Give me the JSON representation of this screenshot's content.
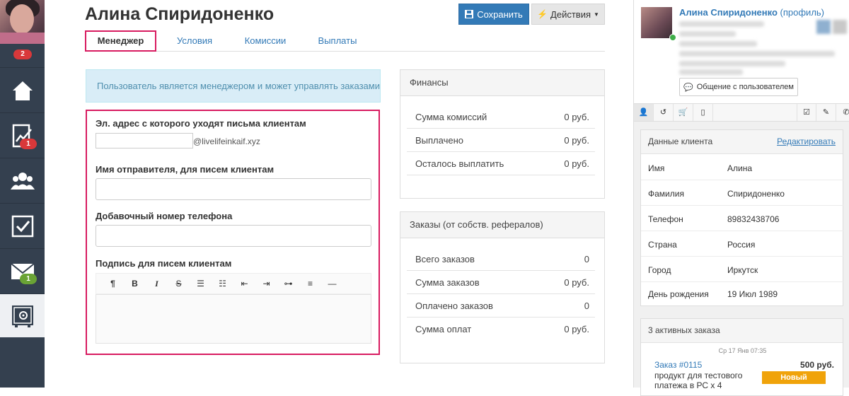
{
  "sidebar": {
    "avatar_badge": "2",
    "items": [
      {
        "name": "home",
        "badge": ""
      },
      {
        "name": "statistics",
        "badge": "1"
      },
      {
        "name": "users",
        "badge": ""
      },
      {
        "name": "tasks",
        "badge": ""
      },
      {
        "name": "mail",
        "badge": "1"
      },
      {
        "name": "safe",
        "badge": ""
      }
    ]
  },
  "header": {
    "title": "Алина Спиридоненко",
    "save_label": "Сохранить",
    "actions_label": "Действия"
  },
  "tabs": [
    {
      "label": "Менеджер",
      "active": true
    },
    {
      "label": "Условия",
      "active": false
    },
    {
      "label": "Комиссии",
      "active": false
    },
    {
      "label": "Выплаты",
      "active": false
    }
  ],
  "info_text": "Пользователь является менеджером и может управлять заказами",
  "form": {
    "email_label": "Эл. адрес с которого уходят письма клиентам",
    "email_value": "",
    "email_suffix": "@livelifeinkaif.xyz",
    "sender_label": "Имя отправителя, для писем клиентам",
    "sender_value": "",
    "phone_label": "Добавочный номер телефона",
    "phone_value": "",
    "signature_label": "Подпись для писем клиентам",
    "toolbar_icons": [
      "paragraph-icon",
      "bold-icon",
      "italic-icon",
      "strikethrough-icon",
      "unordered-list-icon",
      "ordered-list-icon",
      "outdent-icon",
      "indent-icon",
      "link-icon",
      "align-icon",
      "horizontal-rule-icon"
    ]
  },
  "finance": {
    "title": "Финансы",
    "rows": [
      {
        "label": "Сумма комиссий",
        "value": "0 руб."
      },
      {
        "label": "Выплачено",
        "value": "0 руб."
      },
      {
        "label": "Осталось выплатить",
        "value": "0 руб."
      }
    ]
  },
  "orders": {
    "title": "Заказы (от собств. рефералов)",
    "rows": [
      {
        "label": "Всего заказов",
        "value": "0"
      },
      {
        "label": "Сумма заказов",
        "value": "0 руб."
      },
      {
        "label": "Оплачено заказов",
        "value": "0"
      },
      {
        "label": "Сумма оплат",
        "value": "0 руб."
      }
    ]
  },
  "profile": {
    "name": "Алина Спиридоненко",
    "profile_link": "(профиль)",
    "chat_button": "Общение с пользователем",
    "tab_icons": [
      "user-icon",
      "history-icon",
      "cart-icon",
      "mobile-icon",
      "checkbox-icon",
      "pencil-icon",
      "phone-icon"
    ]
  },
  "client": {
    "title": "Данные клиента",
    "edit_label": "Редактировать",
    "rows": [
      {
        "label": "Имя",
        "value": "Алина"
      },
      {
        "label": "Фамилия",
        "value": "Спиридоненко"
      },
      {
        "label": "Телефон",
        "value": "89832438706"
      },
      {
        "label": "Страна",
        "value": "Россия"
      },
      {
        "label": "Город",
        "value": "Иркутск"
      },
      {
        "label": "День рождения",
        "value": "19 Июл 1989"
      }
    ]
  },
  "active_orders": {
    "title": "3 активных заказа",
    "date": "Ср 17 Янв 07:35",
    "order_link": "Заказ #0115",
    "price": "500 руб.",
    "product_line1": "продукт для тестового",
    "product_line2": "платежа в РС х 4",
    "status": "Новый"
  },
  "colors": {
    "sidebar": "#34404f",
    "primary": "#337ab7",
    "highlight": "#d81b60",
    "badge_red": "#d9383a",
    "badge_green": "#6aa335",
    "status_new": "#f0a30a"
  }
}
